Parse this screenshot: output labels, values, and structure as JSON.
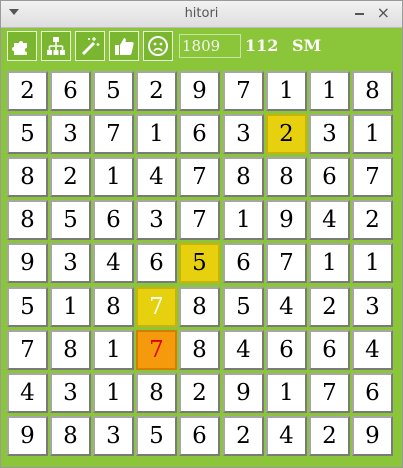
{
  "window": {
    "title": "hitori",
    "close_glyph": "×"
  },
  "toolbar": {
    "buttons": [
      {
        "icon": "puzzle-piece-icon"
      },
      {
        "icon": "hierarchy-tree-icon"
      },
      {
        "icon": "magic-wand-icon"
      },
      {
        "icon": "thumbs-up-icon"
      },
      {
        "icon": "sad-face-icon"
      }
    ],
    "puzzle_number": "1809",
    "count": "112",
    "mode": "SM"
  },
  "board": {
    "rows": [
      [
        2,
        6,
        5,
        2,
        9,
        7,
        1,
        1,
        8
      ],
      [
        5,
        3,
        7,
        1,
        6,
        3,
        2,
        3,
        1
      ],
      [
        8,
        2,
        1,
        4,
        7,
        8,
        8,
        6,
        7
      ],
      [
        8,
        5,
        6,
        3,
        7,
        1,
        9,
        4,
        2
      ],
      [
        9,
        3,
        4,
        6,
        5,
        6,
        7,
        1,
        1
      ],
      [
        5,
        1,
        8,
        7,
        8,
        5,
        4,
        2,
        3
      ],
      [
        7,
        8,
        1,
        7,
        8,
        4,
        6,
        6,
        4
      ],
      [
        4,
        3,
        1,
        8,
        2,
        9,
        1,
        7,
        6
      ],
      [
        9,
        8,
        3,
        5,
        6,
        2,
        4,
        2,
        9
      ]
    ],
    "highlights": [
      {
        "row": 1,
        "col": 6,
        "style": "yellow"
      },
      {
        "row": 4,
        "col": 4,
        "style": "yellow"
      },
      {
        "row": 5,
        "col": 3,
        "style": "yellow-white"
      },
      {
        "row": 6,
        "col": 3,
        "style": "orange"
      }
    ],
    "colors": {
      "yellow": "#e7d10e",
      "orange": "#f49a0c",
      "red_digit": "#e10000",
      "background": "#8ac53a"
    }
  }
}
